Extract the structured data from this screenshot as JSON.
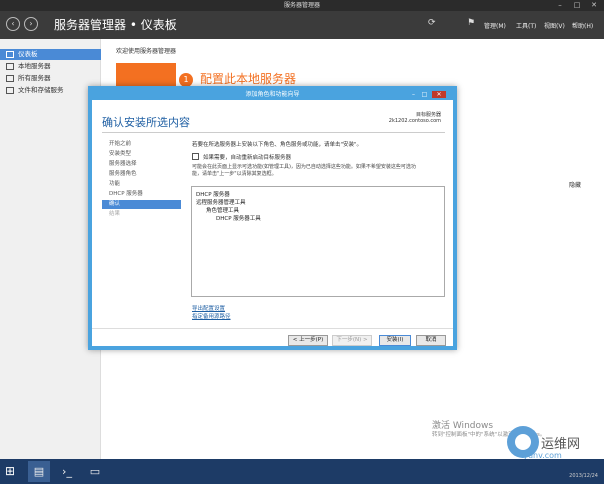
{
  "window": {
    "title": "服务器管理器"
  },
  "header": {
    "breadcrumb_app": "服务器管理器",
    "breadcrumb_sep": "•",
    "breadcrumb_page": "仪表板",
    "menus": [
      "管理(M)",
      "工具(T)",
      "视图(V)",
      "帮助(H)"
    ]
  },
  "sidebar": {
    "items": [
      {
        "label": "仪表板",
        "selected": true
      },
      {
        "label": "本地服务器",
        "selected": false
      },
      {
        "label": "所有服务器",
        "selected": false
      },
      {
        "label": "文件和存储服务",
        "selected": false
      }
    ]
  },
  "main": {
    "welcome": "欢迎使用服务器管理器",
    "config_number": "1",
    "config_text": "配置此本地服务器",
    "hide_label": "隐藏"
  },
  "dialog": {
    "title": "添加角色和功能向导",
    "heading": "确认安装所选内容",
    "dest_label": "目标服务器",
    "dest_value": "2k1202.contoso.com",
    "steps": [
      {
        "label": "开始之前",
        "state": "normal"
      },
      {
        "label": "安装类型",
        "state": "normal"
      },
      {
        "label": "服务器选择",
        "state": "normal"
      },
      {
        "label": "服务器角色",
        "state": "normal"
      },
      {
        "label": "功能",
        "state": "normal"
      },
      {
        "label": "DHCP 服务器",
        "state": "normal"
      },
      {
        "label": "确认",
        "state": "current"
      },
      {
        "label": "结果",
        "state": "disabled"
      }
    ],
    "intro": "若要在所选服务器上安装以下角色、角色服务或功能，请单击\"安装\"。",
    "restart_checkbox": "如果需要，自动重新启动目标服务器",
    "note_line1": "可能会在此页面上显示可选功能(如管理工具)，因为已自动选择这些功能。如果不希望安装这些可选功",
    "note_line2": "能，请单击\"上一步\"以清除其复选框。",
    "selections": [
      {
        "text": "DHCP 服务器",
        "indent": 0
      },
      {
        "text": "远程服务器管理工具",
        "indent": 0
      },
      {
        "text": "角色管理工具",
        "indent": 1
      },
      {
        "text": "DHCP 服务器工具",
        "indent": 2
      }
    ],
    "export_link": "导出配置设置",
    "alt_source_link": "指定备用源路径",
    "buttons": {
      "prev": "< 上一步(P)",
      "next": "下一步(N) >",
      "install": "安装(I)",
      "cancel": "取消"
    }
  },
  "overlay": {
    "activate_title": "激活 Windows",
    "activate_sub": "转到\"控制面板\"中的\"系统\"以激活 Windows。",
    "watermark_text": "运维网",
    "watermark_url": "iyunv.com"
  },
  "taskbar": {
    "date": "2013/12/24"
  },
  "colors": {
    "accent_blue": "#4aa3df",
    "nav_selected": "#4a8ad6",
    "orange": "#f37021",
    "taskbar": "#1d3b66"
  }
}
